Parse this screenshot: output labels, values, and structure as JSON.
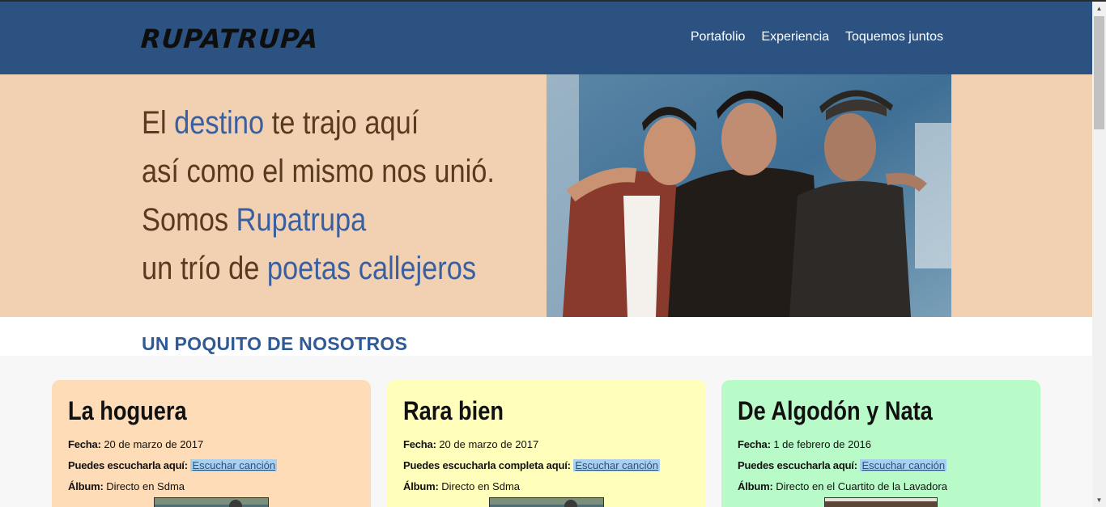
{
  "header": {
    "logo_text": "RUPATRUPA",
    "nav": [
      "Portafolio",
      "Experiencia",
      "Toquemos juntos"
    ]
  },
  "hero": {
    "line1_a": "El ",
    "line1_b": "destino",
    "line1_c": " te trajo aquí",
    "line2": "así como el mismo nos unió.",
    "line3_a": "Somos ",
    "line3_b": "Rupatrupa",
    "line4_a": "un trío de ",
    "line4_b": "poetas callejeros"
  },
  "section": {
    "title": "UN POQUITO DE NOSOTROS"
  },
  "cards": [
    {
      "title": "La hoguera",
      "fecha_label": "Fecha:",
      "fecha": " 20 de marzo de 2017",
      "listen_label": "Puedes escucharla aquí:",
      "listen_link": "Escuchar canción",
      "album_label": "Álbum:",
      "album": " Directo en Sdma"
    },
    {
      "title": "Rara bien",
      "fecha_label": "Fecha:",
      "fecha": " 20 de marzo de 2017",
      "listen_label": "Puedes escucharla completa aquí:",
      "listen_link": "Escuchar canción",
      "album_label": "Álbum:",
      "album": " Directo en Sdma"
    },
    {
      "title": "De Algodón y Nata",
      "fecha_label": "Fecha:",
      "fecha": " 1 de febrero de 2016",
      "listen_label": "Puedes escucharla aquí:",
      "listen_link": "Escuchar canción",
      "album_label": "Álbum:",
      "album": " Directo en el Cuartito de la Lavadora"
    }
  ],
  "colors": {
    "navbar": "#2c5282",
    "hero_bg": "#f1d1b1",
    "card1": "#fddcb7",
    "card2": "#ffffbb",
    "card3": "#b9fbc8"
  }
}
